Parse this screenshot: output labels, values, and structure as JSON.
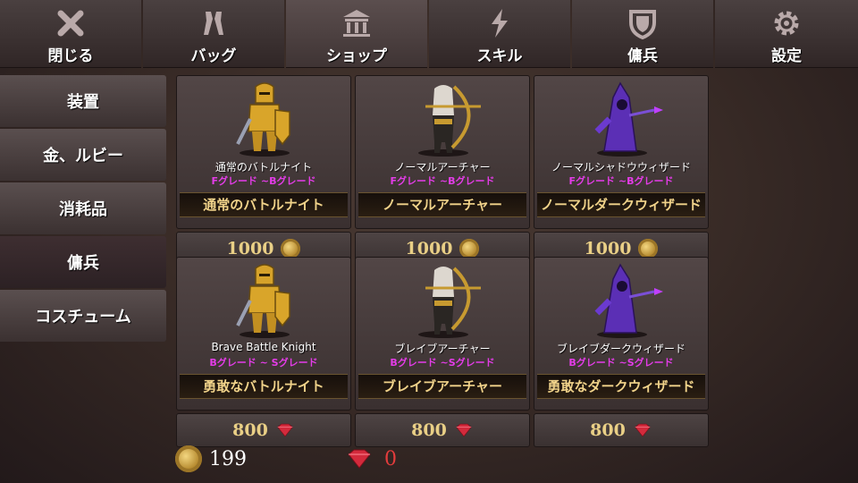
{
  "topbar": {
    "tabs": [
      {
        "label": "閉じる",
        "icon": "close-icon"
      },
      {
        "label": "バッグ",
        "icon": "bag-icon"
      },
      {
        "label": "ショップ",
        "icon": "shop-icon",
        "active": true
      },
      {
        "label": "スキル",
        "icon": "skill-icon"
      },
      {
        "label": "傭兵",
        "icon": "shield-icon"
      },
      {
        "label": "設定",
        "icon": "gear-icon"
      }
    ]
  },
  "sidebar": {
    "items": [
      {
        "label": "装置"
      },
      {
        "label": "金、ルビー"
      },
      {
        "label": "消耗品"
      },
      {
        "label": "傭兵",
        "active": true
      },
      {
        "label": "コスチューム"
      }
    ]
  },
  "products": [
    {
      "name_small": "通常のバトルナイト",
      "grade": "Fグレード ~Bグレード",
      "title": "通常のバトルナイト",
      "price": "1000",
      "currency": "gold",
      "art": "knight"
    },
    {
      "name_small": "ノーマルアーチャー",
      "grade": "Fグレード ~Bグレード",
      "title": "ノーマルアーチャー",
      "price": "1000",
      "currency": "gold",
      "art": "archer"
    },
    {
      "name_small": "ノーマルシャドウウィザード",
      "grade": "Fグレード ~Bグレード",
      "title": "ノーマルダークウィザード",
      "price": "1000",
      "currency": "gold",
      "art": "wizard"
    },
    {
      "name_small": "Brave Battle Knight",
      "grade": "Bグレード ~ Sグレード",
      "title": "勇敢なバトルナイト",
      "price": "800",
      "currency": "ruby",
      "art": "knight"
    },
    {
      "name_small": "ブレイブアーチャー",
      "grade": "Bグレード ~Sグレード",
      "title": "ブレイブアーチャー",
      "price": "800",
      "currency": "ruby",
      "art": "archer"
    },
    {
      "name_small": "ブレイブダークウィザード",
      "grade": "Bグレード ~Sグレード",
      "title": "勇敢なダークウィザード",
      "price": "800",
      "currency": "ruby",
      "art": "wizard"
    }
  ],
  "wallet": {
    "gold": "199",
    "ruby": "0"
  },
  "colors": {
    "grade": "#e43ce8",
    "title_text": "#f1d38a",
    "price_text": "#e9cf86",
    "ruby_value": "#e33c3c"
  }
}
